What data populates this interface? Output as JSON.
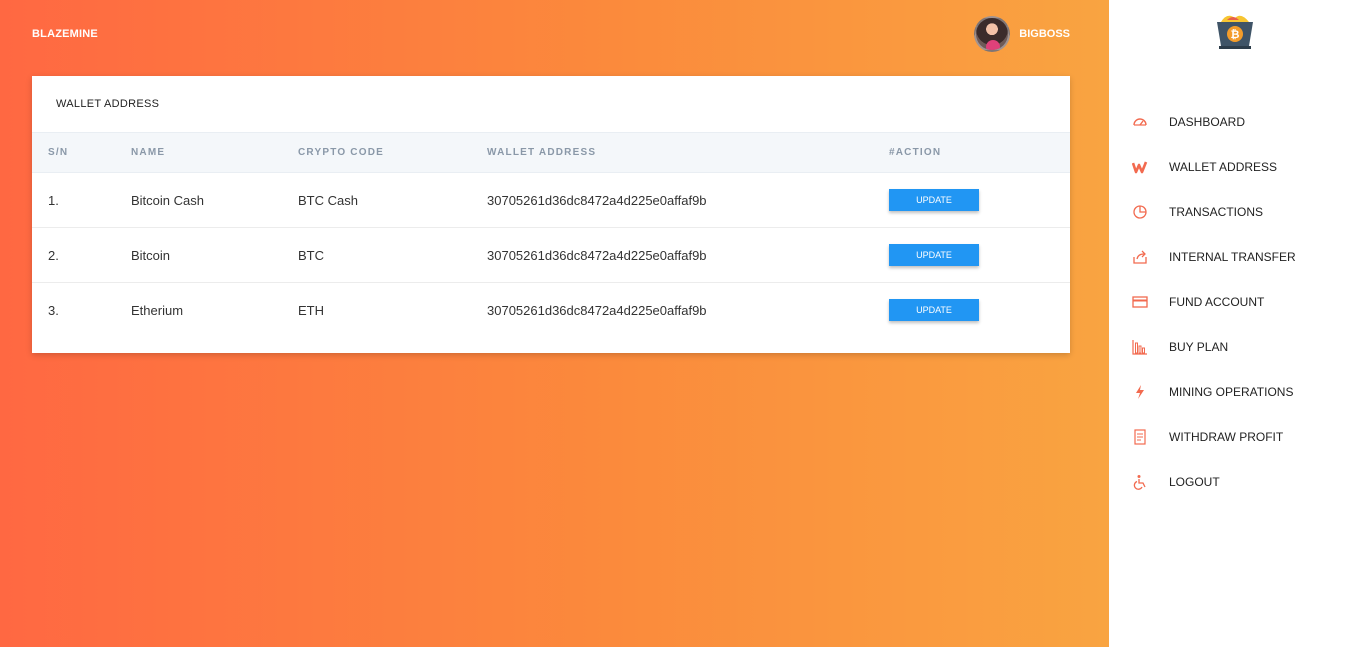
{
  "header": {
    "brand": "BLAZEMINE",
    "username": "BIGBOSS"
  },
  "card": {
    "title": "WALLET ADDRESS",
    "columns": [
      "S/N",
      "NAME",
      "CRYPTO CODE",
      "WALLET ADDRESS",
      "#ACTION"
    ],
    "rows": [
      {
        "sn": "1.",
        "name": "Bitcoin Cash",
        "code": "BTC Cash",
        "address": "30705261d36dc8472a4d225e0affaf9b",
        "action": "UPDATE"
      },
      {
        "sn": "2.",
        "name": "Bitcoin",
        "code": "BTC",
        "address": "30705261d36dc8472a4d225e0affaf9b",
        "action": "UPDATE"
      },
      {
        "sn": "3.",
        "name": "Etherium",
        "code": "ETH",
        "address": "30705261d36dc8472a4d225e0affaf9b",
        "action": "UPDATE"
      }
    ]
  },
  "sidebar": {
    "items": [
      {
        "label": "DASHBOARD",
        "icon": "dashboard-icon"
      },
      {
        "label": "WALLET ADDRESS",
        "icon": "wallet-icon"
      },
      {
        "label": "TRANSACTIONS",
        "icon": "pie-chart-icon"
      },
      {
        "label": "INTERNAL TRANSFER",
        "icon": "share-icon"
      },
      {
        "label": "FUND ACCOUNT",
        "icon": "credit-card-icon"
      },
      {
        "label": "BUY PLAN",
        "icon": "bar-chart-icon"
      },
      {
        "label": "MINING OPERATIONS",
        "icon": "lightning-icon"
      },
      {
        "label": "WITHDRAW PROFIT",
        "icon": "receipt-icon"
      },
      {
        "label": "LOGOUT",
        "icon": "wheelchair-icon"
      }
    ]
  },
  "colors": {
    "accent": "#f26a4f",
    "button": "#2196f3",
    "gradient_start": "#ff6842",
    "gradient_end": "#f9a441"
  }
}
